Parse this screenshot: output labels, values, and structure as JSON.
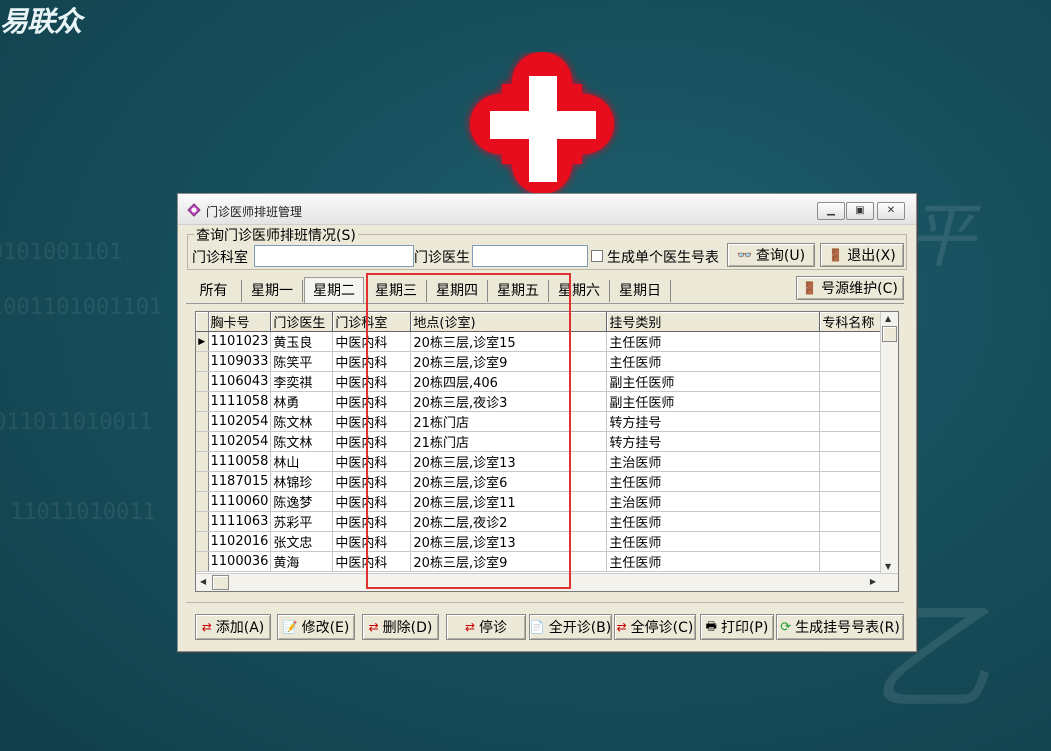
{
  "background": {
    "brand_logo": "易联众",
    "brand_color": "#e8f4f6",
    "accent_red": "#e8101a"
  },
  "window": {
    "title": "门诊医师排班管理",
    "controls": [
      "minimize-icon",
      "maximize-icon",
      "close-icon"
    ]
  },
  "query": {
    "group_title": "查询门诊医师排班情况(S)",
    "dept_label": "门诊科室",
    "dept_value": "",
    "doctor_label": "门诊医生",
    "doctor_value": "",
    "single_doctor_checkbox_label": "生成单个医生号表",
    "single_doctor_checked": false,
    "query_button": "查询(U)",
    "exit_button": "退出(X)"
  },
  "tabs": [
    "所有",
    "星期一",
    "星期二",
    "星期三",
    "星期四",
    "星期五",
    "星期六",
    "星期日"
  ],
  "active_tab": "星期二",
  "source_maintain_button": "号源维护(C)",
  "table": {
    "columns": [
      "胸卡号",
      "门诊医生",
      "门诊科室",
      "地点(诊室)",
      "挂号类别",
      "专科名称"
    ],
    "rows": [
      [
        "1101023",
        "黄玉良",
        "中医内科",
        "20栋三层,诊室15",
        "主任医师",
        ""
      ],
      [
        "1109033",
        "陈笑平",
        "中医内科",
        "20栋三层,诊室9",
        "主任医师",
        ""
      ],
      [
        "1106043",
        "李奕祺",
        "中医内科",
        "20栋四层,406",
        "副主任医师",
        ""
      ],
      [
        "1111058",
        "林勇",
        "中医内科",
        "20栋三层,夜诊3",
        "副主任医师",
        ""
      ],
      [
        "1102054",
        "陈文林",
        "中医内科",
        "21栋门店",
        "转方挂号",
        ""
      ],
      [
        "1102054",
        "陈文林",
        "中医内科",
        "21栋门店",
        "转方挂号",
        ""
      ],
      [
        "1110058",
        "林山",
        "中医内科",
        "20栋三层,诊室13",
        "主治医师",
        ""
      ],
      [
        "1187015",
        "林锦珍",
        "中医内科",
        "20栋三层,诊室6",
        "主任医师",
        ""
      ],
      [
        "1110060",
        "陈逸梦",
        "中医内科",
        "20栋三层,诊室11",
        "主治医师",
        ""
      ],
      [
        "1111063",
        "苏彩平",
        "中医内科",
        "20栋二层,夜诊2",
        "主任医师",
        ""
      ],
      [
        "1102016",
        "张文忠",
        "中医内科",
        "20栋三层,诊室13",
        "主任医师",
        ""
      ],
      [
        "1100036",
        "黄海",
        "中医内科",
        "20栋三层,诊室9",
        "主任医师",
        ""
      ]
    ],
    "selected_row_index": 0
  },
  "bottom_buttons": [
    "添加(A)",
    "修改(E)",
    "删除(D)",
    "停诊",
    "全开诊(B)",
    "全停诊(C)",
    "打印(P)",
    "生成挂号号表(R)"
  ],
  "annotation_color": "#e03030"
}
